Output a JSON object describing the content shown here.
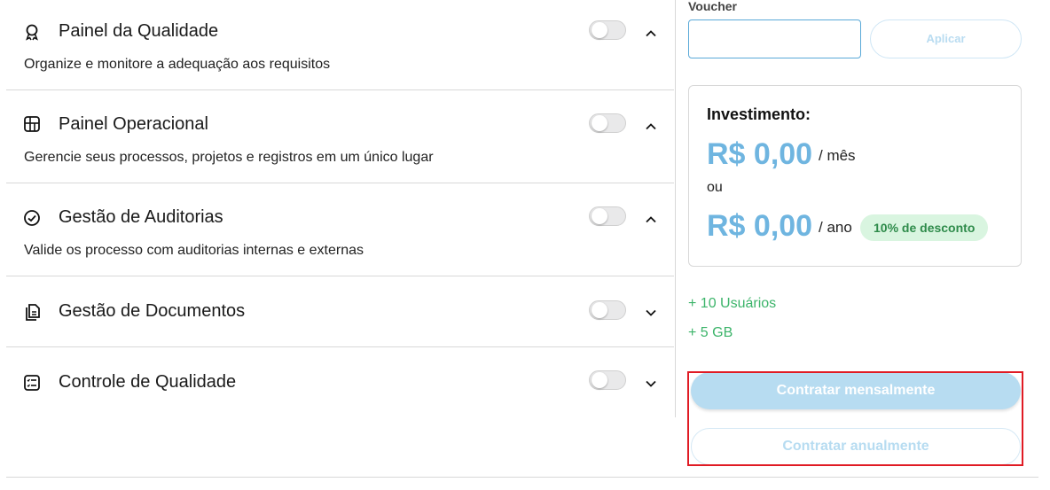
{
  "modules": [
    {
      "title": "Painel da Qualidade",
      "description": "Organize e monitore a adequação aos requisitos",
      "icon": "award-ribbon-icon",
      "enabled": false,
      "expanded": true
    },
    {
      "title": "Painel Operacional",
      "description": "Gerencie seus processos, projetos e registros em um único lugar",
      "icon": "grid-dashboard-icon",
      "enabled": false,
      "expanded": true
    },
    {
      "title": "Gestão de Auditorias",
      "description": "Valide os processo com auditorias internas e externas",
      "icon": "check-circle-icon",
      "enabled": false,
      "expanded": true
    },
    {
      "title": "Gestão de Documentos",
      "description": "",
      "icon": "documents-icon",
      "enabled": false,
      "expanded": false
    },
    {
      "title": "Controle de Qualidade",
      "description": "",
      "icon": "checklist-icon",
      "enabled": false,
      "expanded": false
    }
  ],
  "voucher": {
    "label": "Voucher",
    "value": "",
    "apply_label": "Aplicar"
  },
  "investment": {
    "title": "Investimento:",
    "monthly_price": "R$ 0,00",
    "monthly_suffix": "/ mês",
    "or_label": "ou",
    "yearly_price": "R$ 0,00",
    "yearly_suffix": "/ ano",
    "discount_badge": "10% de desconto"
  },
  "extras": [
    "+ 10 Usuários",
    "+ 5 GB"
  ],
  "actions": {
    "monthly_label": "Contratar mensalmente",
    "yearly_label": "Contratar anualmente"
  },
  "colors": {
    "accent": "#6fb5e0",
    "disabled_button": "#b7dcf1",
    "extras_text": "#3cb46a",
    "highlight_border": "#e01b24",
    "discount_bg": "#d9f5e0"
  }
}
